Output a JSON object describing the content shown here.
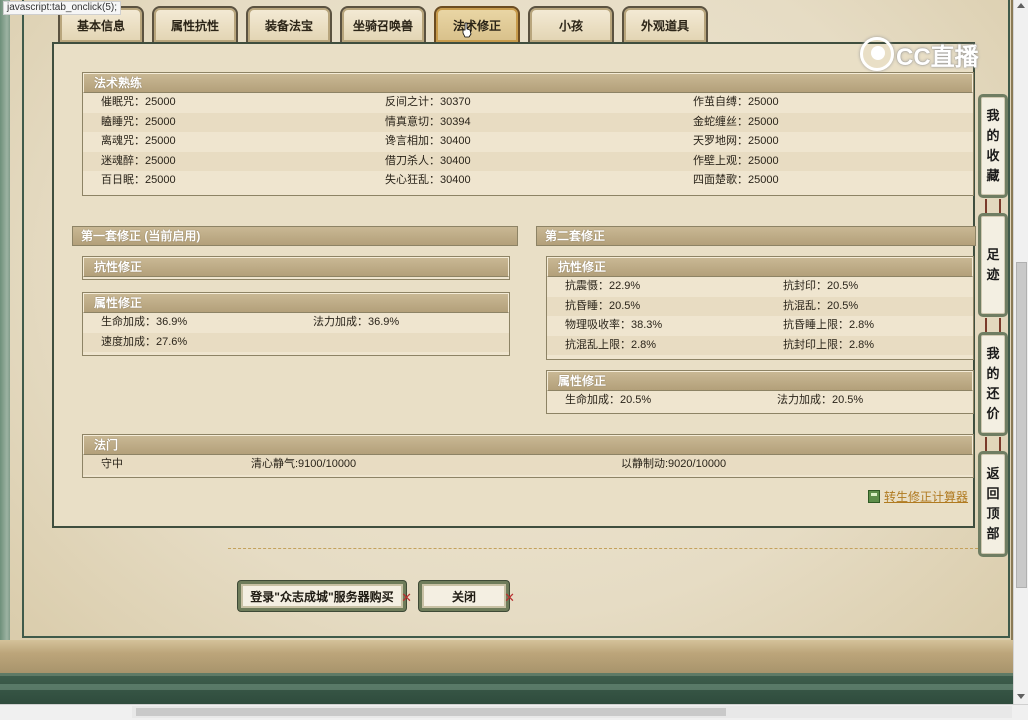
{
  "tabs": [
    {
      "label": "基本信息"
    },
    {
      "label": "属性抗性"
    },
    {
      "label": "装备法宝"
    },
    {
      "label": "坐骑召唤兽"
    },
    {
      "label": "法术修正",
      "active": true
    },
    {
      "label": "小孩"
    },
    {
      "label": "外观道具"
    }
  ],
  "logo_text": "CC直播",
  "spell": {
    "title": "法术熟练",
    "rows": [
      [
        "催眠咒：25000",
        "反间之计：30370",
        "作茧自缚：25000"
      ],
      [
        "瞌睡咒：25000",
        "情真意切：30394",
        "金蛇缠丝：25000"
      ],
      [
        "离魂咒：25000",
        "谗言相加：30400",
        "天罗地网：25000"
      ],
      [
        "迷魂醉：25000",
        "借刀杀人：30400",
        "作壁上观：25000"
      ],
      [
        "百日眠：25000",
        "失心狂乱：30400",
        "四面楚歌：25000"
      ]
    ]
  },
  "set1": {
    "title": "第一套修正 (当前启用)",
    "resist_title": "抗性修正",
    "attr_title": "属性修正",
    "attr_rows": [
      [
        "生命加成：36.9%",
        "法力加成：36.9%"
      ],
      [
        "速度加成：27.6%",
        ""
      ]
    ]
  },
  "set2": {
    "title": "第二套修正",
    "resist_title": "抗性修正",
    "resist_rows": [
      [
        "抗震慑：22.9%",
        "抗封印：20.5%"
      ],
      [
        "抗昏睡：20.5%",
        "抗混乱：20.5%"
      ],
      [
        "物理吸收率：38.3%",
        "抗昏睡上限：2.8%"
      ],
      [
        "抗混乱上限：2.8%",
        "抗封印上限：2.8%"
      ]
    ],
    "attr_title": "属性修正",
    "attr_rows": [
      [
        "生命加成：20.5%",
        "法力加成：20.5%"
      ]
    ]
  },
  "famen": {
    "title": "法门",
    "row": [
      "守中",
      "清心静气:9100/10000",
      "以静制动:9020/10000"
    ]
  },
  "calc_link": "转生修正计算器",
  "buttons": {
    "login": "登录\"众志成城\"服务器购买",
    "close": "关闭"
  },
  "side_tabs": [
    {
      "label": "我的收藏"
    },
    {
      "label": "足迹"
    },
    {
      "label": "我的还价"
    },
    {
      "label": "返回顶部"
    }
  ],
  "status_text": "javascript:tab_onclick(5);"
}
